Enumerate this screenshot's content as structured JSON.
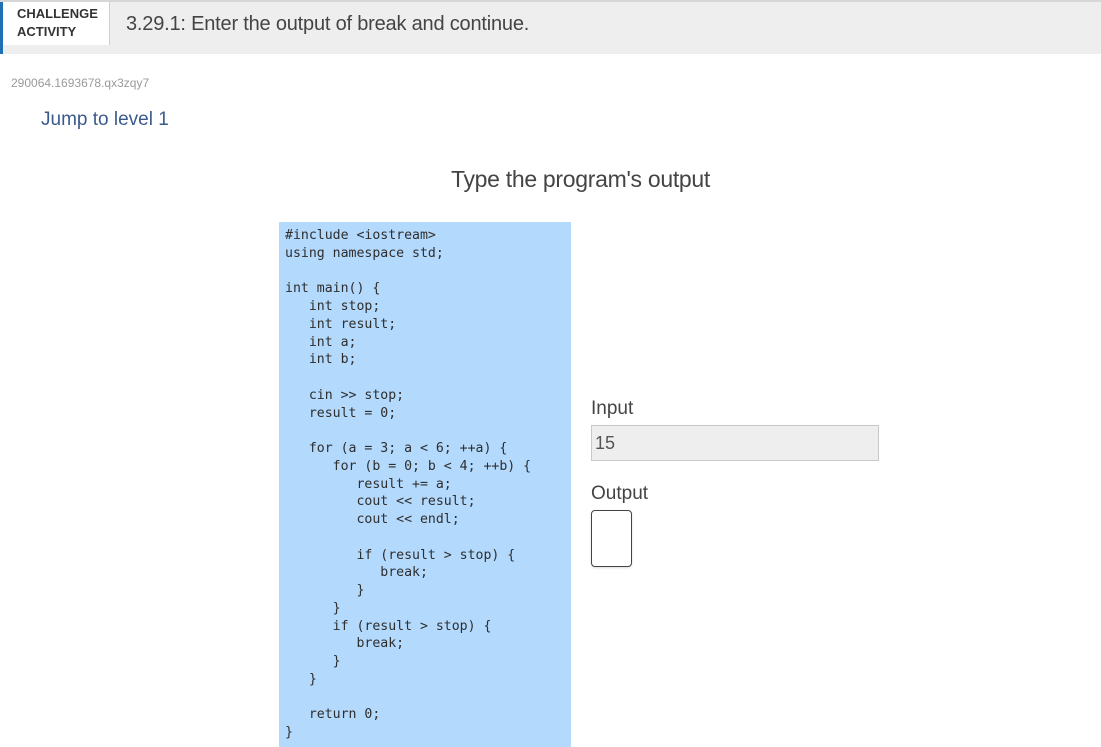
{
  "header": {
    "badge_line1": "CHALLENGE",
    "badge_line2": "ACTIVITY",
    "title": "3.29.1: Enter the output of break and continue."
  },
  "activity_id": "290064.1693678.qx3zqy7",
  "jump_link": "Jump to level 1",
  "instruction": "Type the program's output",
  "code": "#include <iostream>\nusing namespace std;\n\nint main() {\n   int stop;\n   int result;\n   int a;\n   int b;\n\n   cin >> stop;\n   result = 0;\n\n   for (a = 3; a < 6; ++a) {\n      for (b = 0; b < 4; ++b) {\n         result += a;\n         cout << result;\n         cout << endl;\n\n         if (result > stop) {\n            break;\n         }\n      }\n      if (result > stop) {\n         break;\n      }\n   }\n\n   return 0;\n}",
  "input_panel": {
    "label": "Input",
    "value": "15"
  },
  "output_panel": {
    "label": "Output",
    "value": ""
  },
  "colors": {
    "accent": "#1f6fb5",
    "code_background": "#b3d9fc",
    "link": "#3b5a8c"
  }
}
